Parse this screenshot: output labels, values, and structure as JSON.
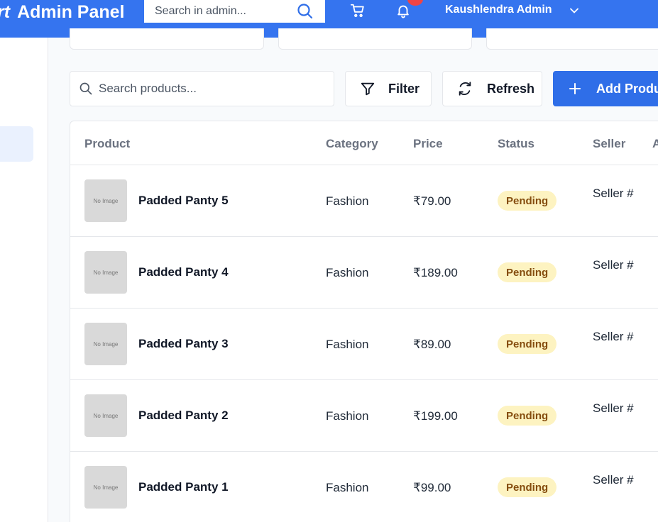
{
  "header": {
    "brand_fragment": "rt",
    "title": "Admin Panel",
    "search_placeholder": "Search in admin...",
    "user_name": "Kaushlendra Admin"
  },
  "toolbar": {
    "search_placeholder": "Search products...",
    "filter_label": "Filter",
    "refresh_label": "Refresh",
    "add_label": "Add Produc"
  },
  "table": {
    "columns": [
      "Product",
      "Category",
      "Price",
      "Status",
      "Seller",
      "A"
    ],
    "rows": [
      {
        "thumb": "No Image",
        "name": "Padded Panty 5",
        "category": "Fashion",
        "price": "₹79.00",
        "status": "Pending",
        "seller": "Seller #"
      },
      {
        "thumb": "No Image",
        "name": "Padded Panty 4",
        "category": "Fashion",
        "price": "₹189.00",
        "status": "Pending",
        "seller": "Seller #"
      },
      {
        "thumb": "No Image",
        "name": "Padded Panty 3",
        "category": "Fashion",
        "price": "₹89.00",
        "status": "Pending",
        "seller": "Seller #"
      },
      {
        "thumb": "No Image",
        "name": "Padded Panty 2",
        "category": "Fashion",
        "price": "₹199.00",
        "status": "Pending",
        "seller": "Seller #"
      },
      {
        "thumb": "No Image",
        "name": "Padded Panty 1",
        "category": "Fashion",
        "price": "₹99.00",
        "status": "Pending",
        "seller": "Seller #"
      }
    ]
  },
  "colors": {
    "primary": "#3574ef",
    "pending_bg": "#fdf3c1",
    "pending_text": "#854d0e",
    "notification": "#ef4444"
  },
  "icons": [
    "search-icon",
    "cart-icon",
    "bell-icon",
    "chevron-down-icon",
    "filter-icon",
    "refresh-icon",
    "plus-icon"
  ]
}
